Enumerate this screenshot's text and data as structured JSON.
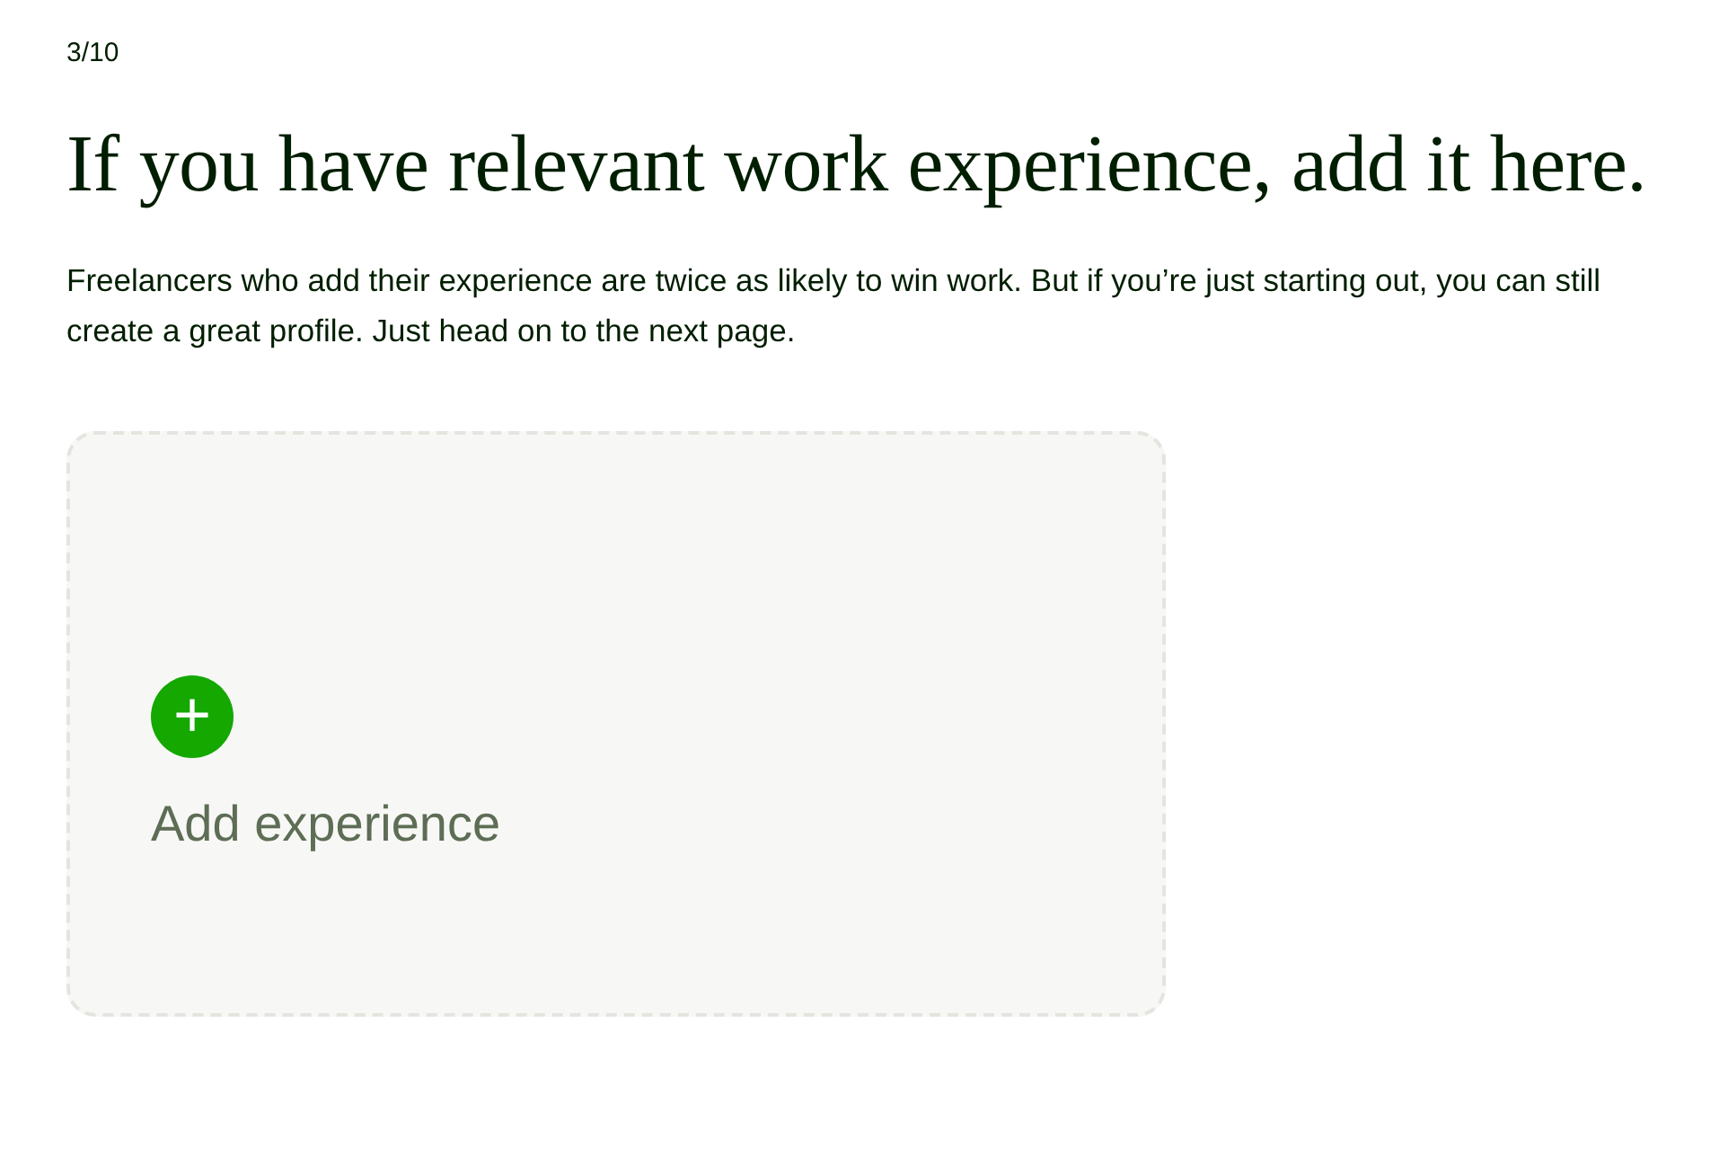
{
  "step": "3/10",
  "heading": "If you have relevant work experience, add it here.",
  "description": "Freelancers who add their experience are twice as likely to win work. But if you’re just starting out, you can still create a great profile. Just head on to the next page.",
  "add_card": {
    "icon": "+",
    "label": "Add experience"
  }
}
